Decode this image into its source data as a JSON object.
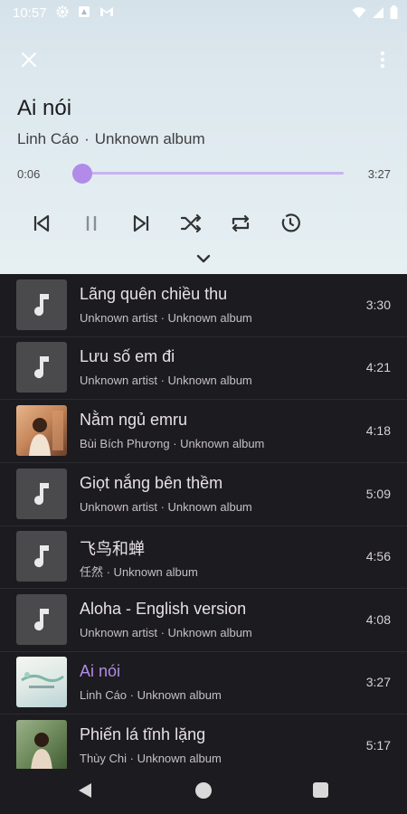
{
  "status": {
    "time": "10:57"
  },
  "now_playing": {
    "title": "Ai nói",
    "artist": "Linh Cáo",
    "separator": "·",
    "album": "Unknown album",
    "current_time": "0:06",
    "total_time": "3:27",
    "progress": 0.03
  },
  "accent_color": "#b28ae8",
  "queue": [
    {
      "title": "Lãng quên chiều thu",
      "sub": "Unknown artist · Unknown album",
      "duration": "3:30",
      "art": "music-note-icon"
    },
    {
      "title": "Lưu số em đi",
      "sub": "Unknown artist · Unknown album",
      "duration": "4:21",
      "art": "music-note-icon"
    },
    {
      "title": "Nằm ngủ emru",
      "sub": "Bùi Bích Phương · Unknown album",
      "duration": "4:18",
      "art": "album-art"
    },
    {
      "title": "Giọt nắng bên thềm",
      "sub": "Unknown artist · Unknown album",
      "duration": "5:09",
      "art": "music-note-icon"
    },
    {
      "title": "飞鸟和蝉",
      "sub": "任然 · Unknown album",
      "duration": "4:56",
      "art": "music-note-icon"
    },
    {
      "title": "Aloha - English version",
      "sub": "Unknown artist · Unknown album",
      "duration": "4:08",
      "art": "music-note-icon"
    },
    {
      "title": "Ai nói",
      "sub": "Linh Cáo · Unknown album",
      "duration": "3:27",
      "art": "album-art",
      "active": true
    },
    {
      "title": "Phiến lá tĩnh lặng",
      "sub": "Thùy Chi · Unknown album",
      "duration": "5:17",
      "art": "album-art"
    }
  ]
}
